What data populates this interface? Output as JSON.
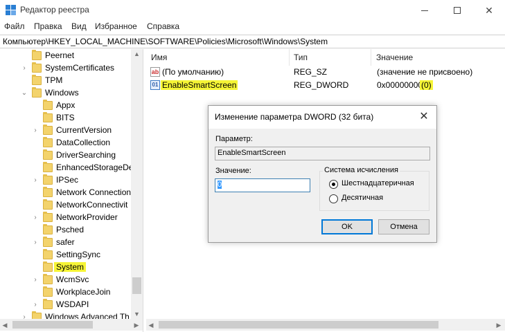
{
  "window": {
    "title": "Редактор реестра",
    "icon": "regedit-icon"
  },
  "menu": [
    "Файл",
    "Правка",
    "Вид",
    "Избранное",
    "Справка"
  ],
  "address": "Компьютер\\HKEY_LOCAL_MACHINE\\SOFTWARE\\Policies\\Microsoft\\Windows\\System",
  "tree": {
    "items": [
      {
        "label": "Peernet",
        "level": 1,
        "expander": "none"
      },
      {
        "label": "SystemCertificates",
        "level": 1,
        "expander": "collapsed"
      },
      {
        "label": "TPM",
        "level": 1,
        "expander": "none"
      },
      {
        "label": "Windows",
        "level": 1,
        "expander": "expanded"
      },
      {
        "label": "Appx",
        "level": 2,
        "expander": "none"
      },
      {
        "label": "BITS",
        "level": 2,
        "expander": "none"
      },
      {
        "label": "CurrentVersion",
        "level": 2,
        "expander": "collapsed"
      },
      {
        "label": "DataCollection",
        "level": 2,
        "expander": "none"
      },
      {
        "label": "DriverSearching",
        "level": 2,
        "expander": "none"
      },
      {
        "label": "EnhancedStorageDe",
        "level": 2,
        "expander": "none"
      },
      {
        "label": "IPSec",
        "level": 2,
        "expander": "collapsed"
      },
      {
        "label": "Network Connection",
        "level": 2,
        "expander": "none"
      },
      {
        "label": "NetworkConnectivit",
        "level": 2,
        "expander": "none"
      },
      {
        "label": "NetworkProvider",
        "level": 2,
        "expander": "collapsed"
      },
      {
        "label": "Psched",
        "level": 2,
        "expander": "none"
      },
      {
        "label": "safer",
        "level": 2,
        "expander": "collapsed"
      },
      {
        "label": "SettingSync",
        "level": 2,
        "expander": "none"
      },
      {
        "label": "System",
        "level": 2,
        "expander": "none",
        "selected": true
      },
      {
        "label": "WcmSvc",
        "level": 2,
        "expander": "collapsed"
      },
      {
        "label": "WorkplaceJoin",
        "level": 2,
        "expander": "none"
      },
      {
        "label": "WSDAPI",
        "level": 2,
        "expander": "collapsed"
      },
      {
        "label": "Windows Advanced Th",
        "level": 1,
        "expander": "collapsed"
      }
    ]
  },
  "list": {
    "columns": [
      "Имя",
      "Тип",
      "Значение"
    ],
    "rows": [
      {
        "icon": "string-value-icon",
        "name": "(По умолчанию)",
        "type": "REG_SZ",
        "value_main": "(значение не присвоено)",
        "value_extra": ""
      },
      {
        "icon": "dword-value-icon",
        "name": "EnableSmartScreen",
        "type": "REG_DWORD",
        "value_main": "0x00000000",
        "value_extra": "(0)"
      }
    ]
  },
  "dialog": {
    "title": "Изменение параметра DWORD (32 бита)",
    "param_label": "Параметр:",
    "param_value": "EnableSmartScreen",
    "value_label": "Значение:",
    "value_input": "0",
    "base_group_title": "Система исчисления",
    "base_options": [
      {
        "label": "Шестнадцатеричная",
        "checked": true
      },
      {
        "label": "Десятичная",
        "checked": false
      }
    ],
    "ok_label": "OK",
    "cancel_label": "Отмена"
  },
  "colors": {
    "highlight": "#f6f536",
    "accent": "#0078d7"
  }
}
